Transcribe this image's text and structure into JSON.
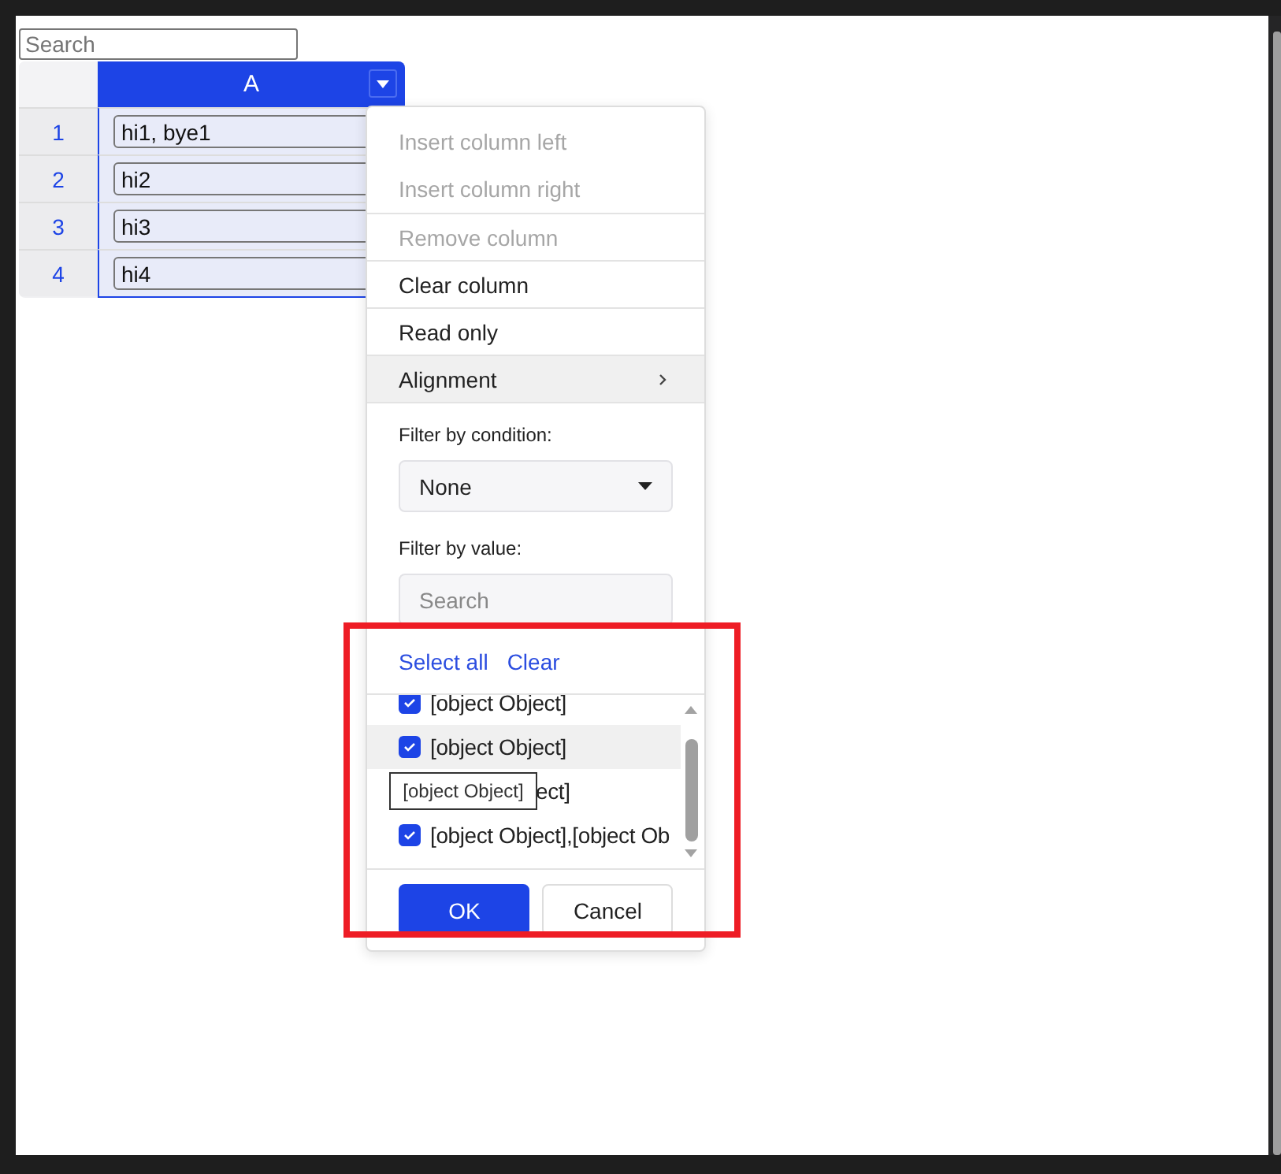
{
  "search": {
    "placeholder": "Search"
  },
  "table": {
    "columns": [
      {
        "label": "A",
        "selected": true
      }
    ],
    "rows": [
      {
        "header": "1",
        "cell": "hi1, bye1"
      },
      {
        "header": "2",
        "cell": "hi2"
      },
      {
        "header": "3",
        "cell": "hi3"
      },
      {
        "header": "4",
        "cell": "hi4"
      }
    ]
  },
  "column_menu": {
    "items": [
      {
        "label": "Insert column left",
        "disabled": true,
        "divider_above": false,
        "hovered": false,
        "kind": "action"
      },
      {
        "label": "Insert column right",
        "disabled": true,
        "divider_above": false,
        "hovered": false,
        "kind": "action"
      },
      {
        "label": "Remove column",
        "disabled": true,
        "divider_above": true,
        "hovered": false,
        "kind": "action"
      },
      {
        "label": "Clear column",
        "disabled": false,
        "divider_above": true,
        "hovered": false,
        "kind": "action"
      },
      {
        "label": "Read only",
        "disabled": false,
        "divider_above": true,
        "hovered": false,
        "kind": "action"
      },
      {
        "label": "Alignment",
        "disabled": false,
        "divider_above": true,
        "hovered": true,
        "kind": "submenu"
      }
    ],
    "filter_by_condition": {
      "label": "Filter by condition:",
      "value": "None"
    },
    "filter_by_value": {
      "label": "Filter by value:",
      "placeholder": "Search",
      "actions": [
        "Select all",
        "Clear"
      ],
      "values": [
        {
          "label": "[object Object]",
          "checked": true,
          "hovered": false,
          "kind": "item"
        },
        {
          "label": "[object Object]",
          "checked": true,
          "hovered": true,
          "kind": "item"
        },
        {
          "label": "ect]",
          "kind": "covered"
        },
        {
          "label": "[object Object],[object Ob",
          "checked": true,
          "hovered": false,
          "kind": "item"
        }
      ]
    },
    "buttons": [
      {
        "label": "OK",
        "kind": "primary"
      },
      {
        "label": "Cancel",
        "kind": "secondary"
      }
    ]
  },
  "tooltip": {
    "text": "[object Object]"
  },
  "annotation": {
    "kind": "highlight-box"
  }
}
